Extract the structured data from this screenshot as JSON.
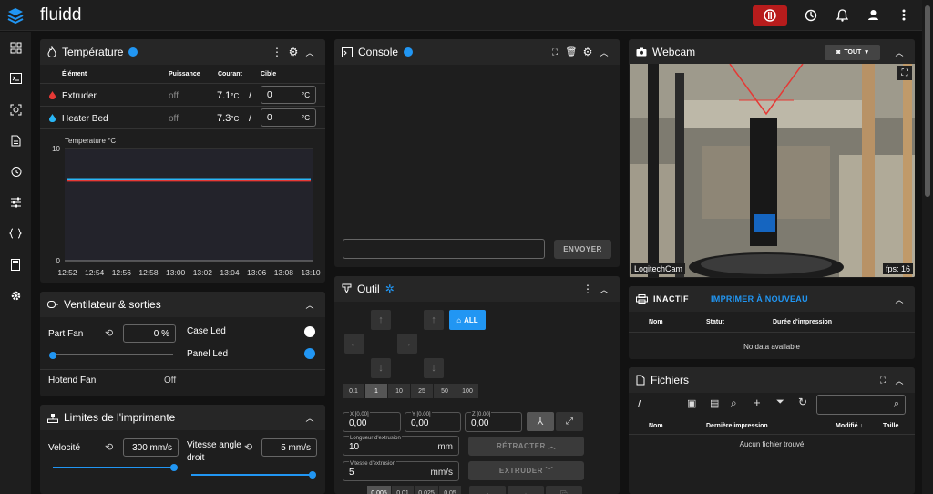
{
  "app": {
    "title": "fluidd"
  },
  "temperature": {
    "title": "Température",
    "headers": {
      "element": "Élément",
      "power": "Puissance",
      "current": "Courant",
      "target": "Cible"
    },
    "rows": [
      {
        "name": "Extruder",
        "power": "off",
        "current": "7.1",
        "unit": "°C",
        "sep": "/",
        "target": "0",
        "target_unit": "°C",
        "color": "#e53935"
      },
      {
        "name": "Heater Bed",
        "power": "off",
        "current": "7.3",
        "unit": "°C",
        "sep": "/",
        "target": "0",
        "target_unit": "°C",
        "color": "#29b6f6"
      }
    ],
    "chart_label": "Temperature °C"
  },
  "chart_data": {
    "type": "line",
    "title": "Temperature °C",
    "x": [
      "12:52",
      "12:54",
      "12:56",
      "12:58",
      "13:00",
      "13:02",
      "13:04",
      "13:06",
      "13:08",
      "13:10"
    ],
    "ylim": [
      0,
      10
    ],
    "yticks": [
      "10",
      "0"
    ],
    "series": [
      {
        "color": "#e53935",
        "values": [
          7.1,
          7.1,
          7.1,
          7.1,
          7.1,
          7.1,
          7.1,
          7.1,
          7.1,
          7.1
        ]
      },
      {
        "color": "#29b6f6",
        "values": [
          7.3,
          7.3,
          7.3,
          7.3,
          7.3,
          7.3,
          7.3,
          7.3,
          7.3,
          7.3
        ]
      }
    ]
  },
  "fans": {
    "title": "Ventilateur & sorties",
    "part_fan": {
      "label": "Part Fan",
      "value": "0 %",
      "level": 0
    },
    "case_led": {
      "label": "Case Led"
    },
    "panel_led": {
      "label": "Panel Led"
    },
    "hotend_fan": {
      "label": "Hotend Fan",
      "value": "Off"
    }
  },
  "limits": {
    "title": "Limites de l'imprimante",
    "velocity": {
      "label": "Velocité",
      "value": "300 mm/s"
    },
    "square": {
      "label": "Vitesse angle droit",
      "value": "5 mm/s"
    }
  },
  "console": {
    "title": "Console",
    "send": "ENVOYER"
  },
  "tool": {
    "title": "Outil",
    "home_all": "ALL",
    "steps": [
      "0.1",
      "1",
      "10",
      "25",
      "50",
      "100"
    ],
    "x": {
      "label": "X [0.00]",
      "value": "0,00"
    },
    "y": {
      "label": "Y [0.00]",
      "value": "0,00"
    },
    "z": {
      "label": "Z [0.00]",
      "value": "0,00"
    },
    "extrude_len": {
      "label": "Longueur d'extrusion",
      "value": "10",
      "unit": "mm"
    },
    "extrude_speed": {
      "label": "Vitesse d'extrusion",
      "value": "5",
      "unit": "mm/s"
    },
    "retract": "RÉTRACTER",
    "extrude": "EXTRUDER",
    "z_steps": [
      "0.005",
      "0.01",
      "0.025",
      "0.05"
    ]
  },
  "webcam": {
    "title": "Webcam",
    "filter": "TOUT",
    "camera": "LogitechCam",
    "fps": "fps: 16"
  },
  "jobs": {
    "status": "INACTIF",
    "reprint": "IMPRIMER À NOUVEAU",
    "headers": {
      "name": "Nom",
      "status": "Statut",
      "duration": "Durée d'impression"
    },
    "empty": "No data available"
  },
  "files": {
    "title": "Fichiers",
    "path": "/",
    "headers": {
      "name": "Nom",
      "last": "Dernière impression",
      "modified": "Modifié",
      "size": "Taille"
    },
    "empty": "Aucun fichier trouvé"
  }
}
